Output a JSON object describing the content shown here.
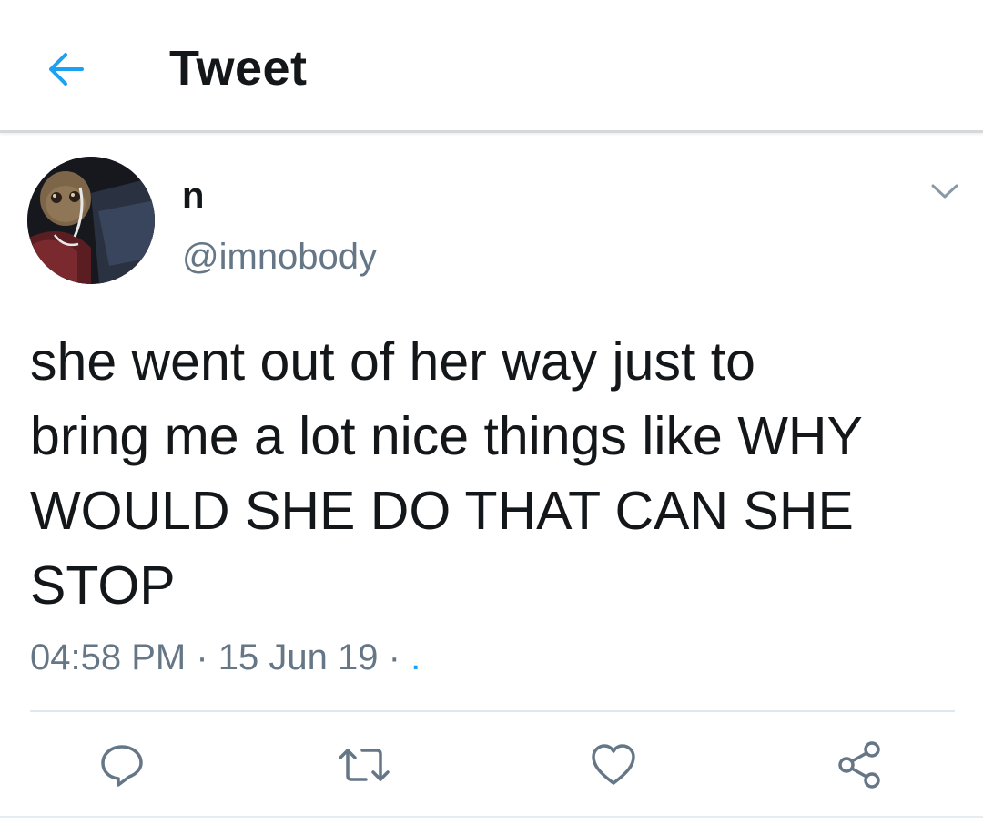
{
  "header": {
    "title": "Tweet",
    "back_icon": "arrow-left-icon",
    "accent_color": "#1da1f2"
  },
  "author": {
    "display_name": "n",
    "handle": "@imnobody",
    "avatar_icon": "avatar-image"
  },
  "tweet": {
    "text": "she went out of her way just to\nbring me a lot nice things like WHY\nWOULD SHE DO THAT CAN SHE\nSTOP",
    "time": "04:58 PM",
    "separator": "·",
    "date": "15 Jun 19",
    "source": "."
  },
  "actions": [
    {
      "name": "reply",
      "icon": "reply-icon"
    },
    {
      "name": "retweet",
      "icon": "retweet-icon"
    },
    {
      "name": "like",
      "icon": "heart-icon"
    },
    {
      "name": "share",
      "icon": "share-icon"
    }
  ],
  "colors": {
    "text_primary": "#14171a",
    "text_secondary": "#657786",
    "divider": "#e1e8ed"
  }
}
